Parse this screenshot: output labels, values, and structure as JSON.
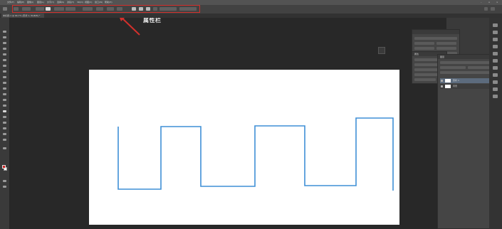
{
  "menubar": {
    "items": [
      "文件(F)",
      "编辑(E)",
      "图像(I)",
      "图层(L)",
      "文字(Y)",
      "选择(S)",
      "滤镜(T)",
      "3D(D)",
      "视图(V)",
      "窗口(W)",
      "帮助(H)"
    ]
  },
  "options_bar": {
    "callout_label": "属性栏"
  },
  "document": {
    "tab_label": "未标题-1 @ 66.7% (形状 1, RGB/8) *"
  },
  "layers_panel": {
    "title": "图层",
    "layers": [
      "形状 1",
      "背景"
    ]
  },
  "properties_panel": {
    "title": "属性"
  },
  "colors": {
    "foreground": "#cc2222",
    "background": "#ffffff",
    "path_stroke": "#3f8fd6",
    "callout_frame": "#d3302c"
  }
}
